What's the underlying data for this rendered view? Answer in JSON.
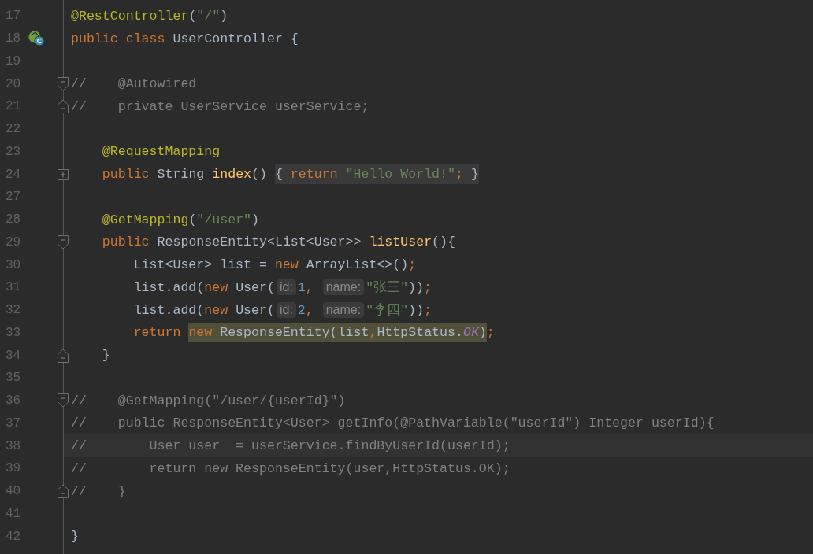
{
  "editor": {
    "lines": [
      {
        "number": "17",
        "tokens": [
          {
            "kind": "annotation",
            "t": "@RestController"
          },
          {
            "kind": "plain",
            "t": "("
          },
          {
            "kind": "string",
            "t": "\"/\""
          },
          {
            "kind": "plain",
            "t": ")"
          }
        ]
      },
      {
        "number": "18",
        "class_marker": true,
        "tokens": [
          {
            "kind": "keyword",
            "t": "public class"
          },
          {
            "kind": "plain",
            "t": " UserController {"
          }
        ]
      },
      {
        "number": "19"
      },
      {
        "number": "20",
        "fold_start": true,
        "tokens": [
          {
            "kind": "comment",
            "t": "//    @Autowired"
          }
        ]
      },
      {
        "number": "21",
        "fold_end": true,
        "tokens": [
          {
            "kind": "comment",
            "t": "//    private UserService userService;"
          }
        ]
      },
      {
        "number": "22"
      },
      {
        "number": "23",
        "tokens": [
          {
            "kind": "annotation",
            "t": "    @RequestMapping"
          }
        ]
      },
      {
        "number": "24",
        "collapsed": true,
        "tokens": [
          {
            "kind": "keyword",
            "t": "    public"
          },
          {
            "kind": "plain",
            "t": " String "
          },
          {
            "kind": "method",
            "t": "index"
          },
          {
            "kind": "plain",
            "t": "() "
          },
          {
            "kind": "folded",
            "tokens": [
              {
                "kind": "plain",
                "t": "{ "
              },
              {
                "kind": "keyword",
                "t": "return "
              },
              {
                "kind": "string",
                "t": "\"Hello World!\""
              },
              {
                "kind": "keyword",
                "t": ";"
              },
              {
                "kind": "plain",
                "t": " }"
              }
            ]
          }
        ]
      },
      {
        "number": "27"
      },
      {
        "number": "28",
        "tokens": [
          {
            "kind": "annotation",
            "t": "    @GetMapping"
          },
          {
            "kind": "plain",
            "t": "("
          },
          {
            "kind": "string",
            "t": "\"/user\""
          },
          {
            "kind": "plain",
            "t": ")"
          }
        ]
      },
      {
        "number": "29",
        "fold_start": true,
        "tokens": [
          {
            "kind": "keyword",
            "t": "    public"
          },
          {
            "kind": "plain",
            "t": " ResponseEntity<List<User>> "
          },
          {
            "kind": "method",
            "t": "listUser"
          },
          {
            "kind": "plain",
            "t": "(){"
          }
        ]
      },
      {
        "number": "30",
        "tokens": [
          {
            "kind": "plain",
            "t": "        List<User> list = "
          },
          {
            "kind": "keyword",
            "t": "new"
          },
          {
            "kind": "plain",
            "t": " ArrayList<>()"
          },
          {
            "kind": "keyword",
            "t": ";"
          }
        ]
      },
      {
        "number": "31",
        "tokens": [
          {
            "kind": "plain",
            "t": "        list.add("
          },
          {
            "kind": "keyword",
            "t": "new"
          },
          {
            "kind": "plain",
            "t": " User("
          },
          {
            "kind": "hint",
            "t": "id:"
          },
          {
            "kind": "number",
            "t": "1"
          },
          {
            "kind": "keyword",
            "t": ", "
          },
          {
            "kind": "hint",
            "t": "name:"
          },
          {
            "kind": "string",
            "t": "\"张三\""
          },
          {
            "kind": "plain",
            "t": "))"
          },
          {
            "kind": "keyword",
            "t": ";"
          }
        ]
      },
      {
        "number": "32",
        "tokens": [
          {
            "kind": "plain",
            "t": "        list.add("
          },
          {
            "kind": "keyword",
            "t": "new"
          },
          {
            "kind": "plain",
            "t": " User("
          },
          {
            "kind": "hint",
            "t": "id:"
          },
          {
            "kind": "number",
            "t": "2"
          },
          {
            "kind": "keyword",
            "t": ", "
          },
          {
            "kind": "hint",
            "t": "name:"
          },
          {
            "kind": "string",
            "t": "\"李四\""
          },
          {
            "kind": "plain",
            "t": "))"
          },
          {
            "kind": "keyword",
            "t": ";"
          }
        ]
      },
      {
        "number": "33",
        "tokens": [
          {
            "kind": "keyword",
            "t": "        return "
          },
          {
            "kind": "highlight",
            "tokens": [
              {
                "kind": "keyword",
                "t": "new"
              },
              {
                "kind": "plain",
                "t": " ResponseEntity(list"
              },
              {
                "kind": "keyword",
                "t": ","
              },
              {
                "kind": "plain",
                "t": "HttpStatus."
              },
              {
                "kind": "constant",
                "t": "OK"
              },
              {
                "kind": "plain",
                "t": ")"
              }
            ]
          },
          {
            "kind": "keyword",
            "t": ";"
          }
        ]
      },
      {
        "number": "34",
        "fold_end": true,
        "tokens": [
          {
            "kind": "plain",
            "t": "    }"
          }
        ]
      },
      {
        "number": "35"
      },
      {
        "number": "36",
        "fold_start": true,
        "tokens": [
          {
            "kind": "comment",
            "t": "//    @GetMapping(\"/user/{userId}\")"
          }
        ]
      },
      {
        "number": "37",
        "tokens": [
          {
            "kind": "comment",
            "t": "//    public ResponseEntity<User> getInfo(@PathVariable(\"userId\") Integer userId){"
          }
        ]
      },
      {
        "number": "38",
        "current": true,
        "tokens": [
          {
            "kind": "comment",
            "t": "//        User user  = userService.findByUserId(userId);"
          }
        ]
      },
      {
        "number": "39",
        "tokens": [
          {
            "kind": "comment",
            "t": "//        return new ResponseEntity(user,HttpStatus.OK);"
          }
        ]
      },
      {
        "number": "40",
        "fold_end": true,
        "tokens": [
          {
            "kind": "comment",
            "t": "//    }"
          }
        ]
      },
      {
        "number": "41"
      },
      {
        "number": "42",
        "tokens": [
          {
            "kind": "plain",
            "t": "}"
          }
        ]
      }
    ]
  }
}
